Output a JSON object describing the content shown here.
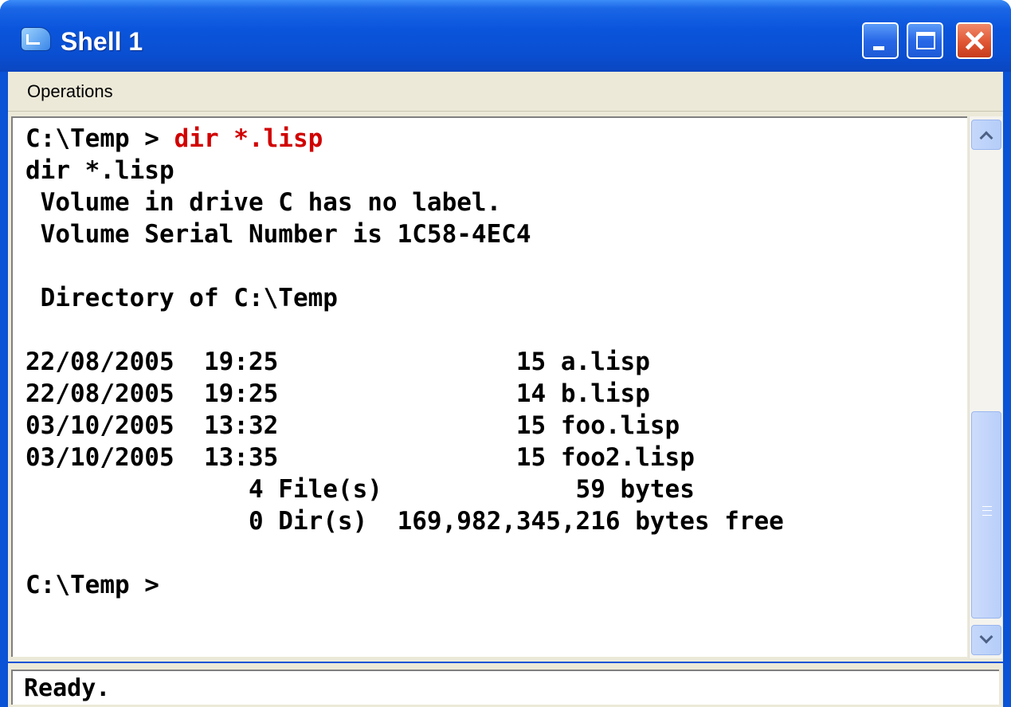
{
  "window": {
    "title": "Shell 1",
    "colors": {
      "title_bar": "#0a52d6",
      "command_text": "#d10000",
      "close_button": "#e05634"
    }
  },
  "menubar": {
    "items": [
      "Operations"
    ]
  },
  "console": {
    "lines": [
      {
        "prompt": "C:\\Temp > ",
        "command": "dir *.lisp"
      },
      {
        "text": "dir *.lisp"
      },
      {
        "text": " Volume in drive C has no label."
      },
      {
        "text": " Volume Serial Number is 1C58-4EC4"
      },
      {
        "text": ""
      },
      {
        "text": " Directory of C:\\Temp"
      },
      {
        "text": ""
      },
      {
        "text": "22/08/2005  19:25                15 a.lisp"
      },
      {
        "text": "22/08/2005  19:25                14 b.lisp"
      },
      {
        "text": "03/10/2005  13:32                15 foo.lisp"
      },
      {
        "text": "03/10/2005  13:35                15 foo2.lisp"
      },
      {
        "text": "               4 File(s)             59 bytes"
      },
      {
        "text": "               0 Dir(s)  169,982,345,216 bytes free"
      },
      {
        "text": ""
      },
      {
        "text": "C:\\Temp >"
      }
    ]
  },
  "scrollbar": {
    "up_icon": "chevron-up-icon",
    "down_icon": "chevron-down-icon",
    "thumb_icon": "grip-icon"
  },
  "statusbar": {
    "text": "Ready."
  }
}
